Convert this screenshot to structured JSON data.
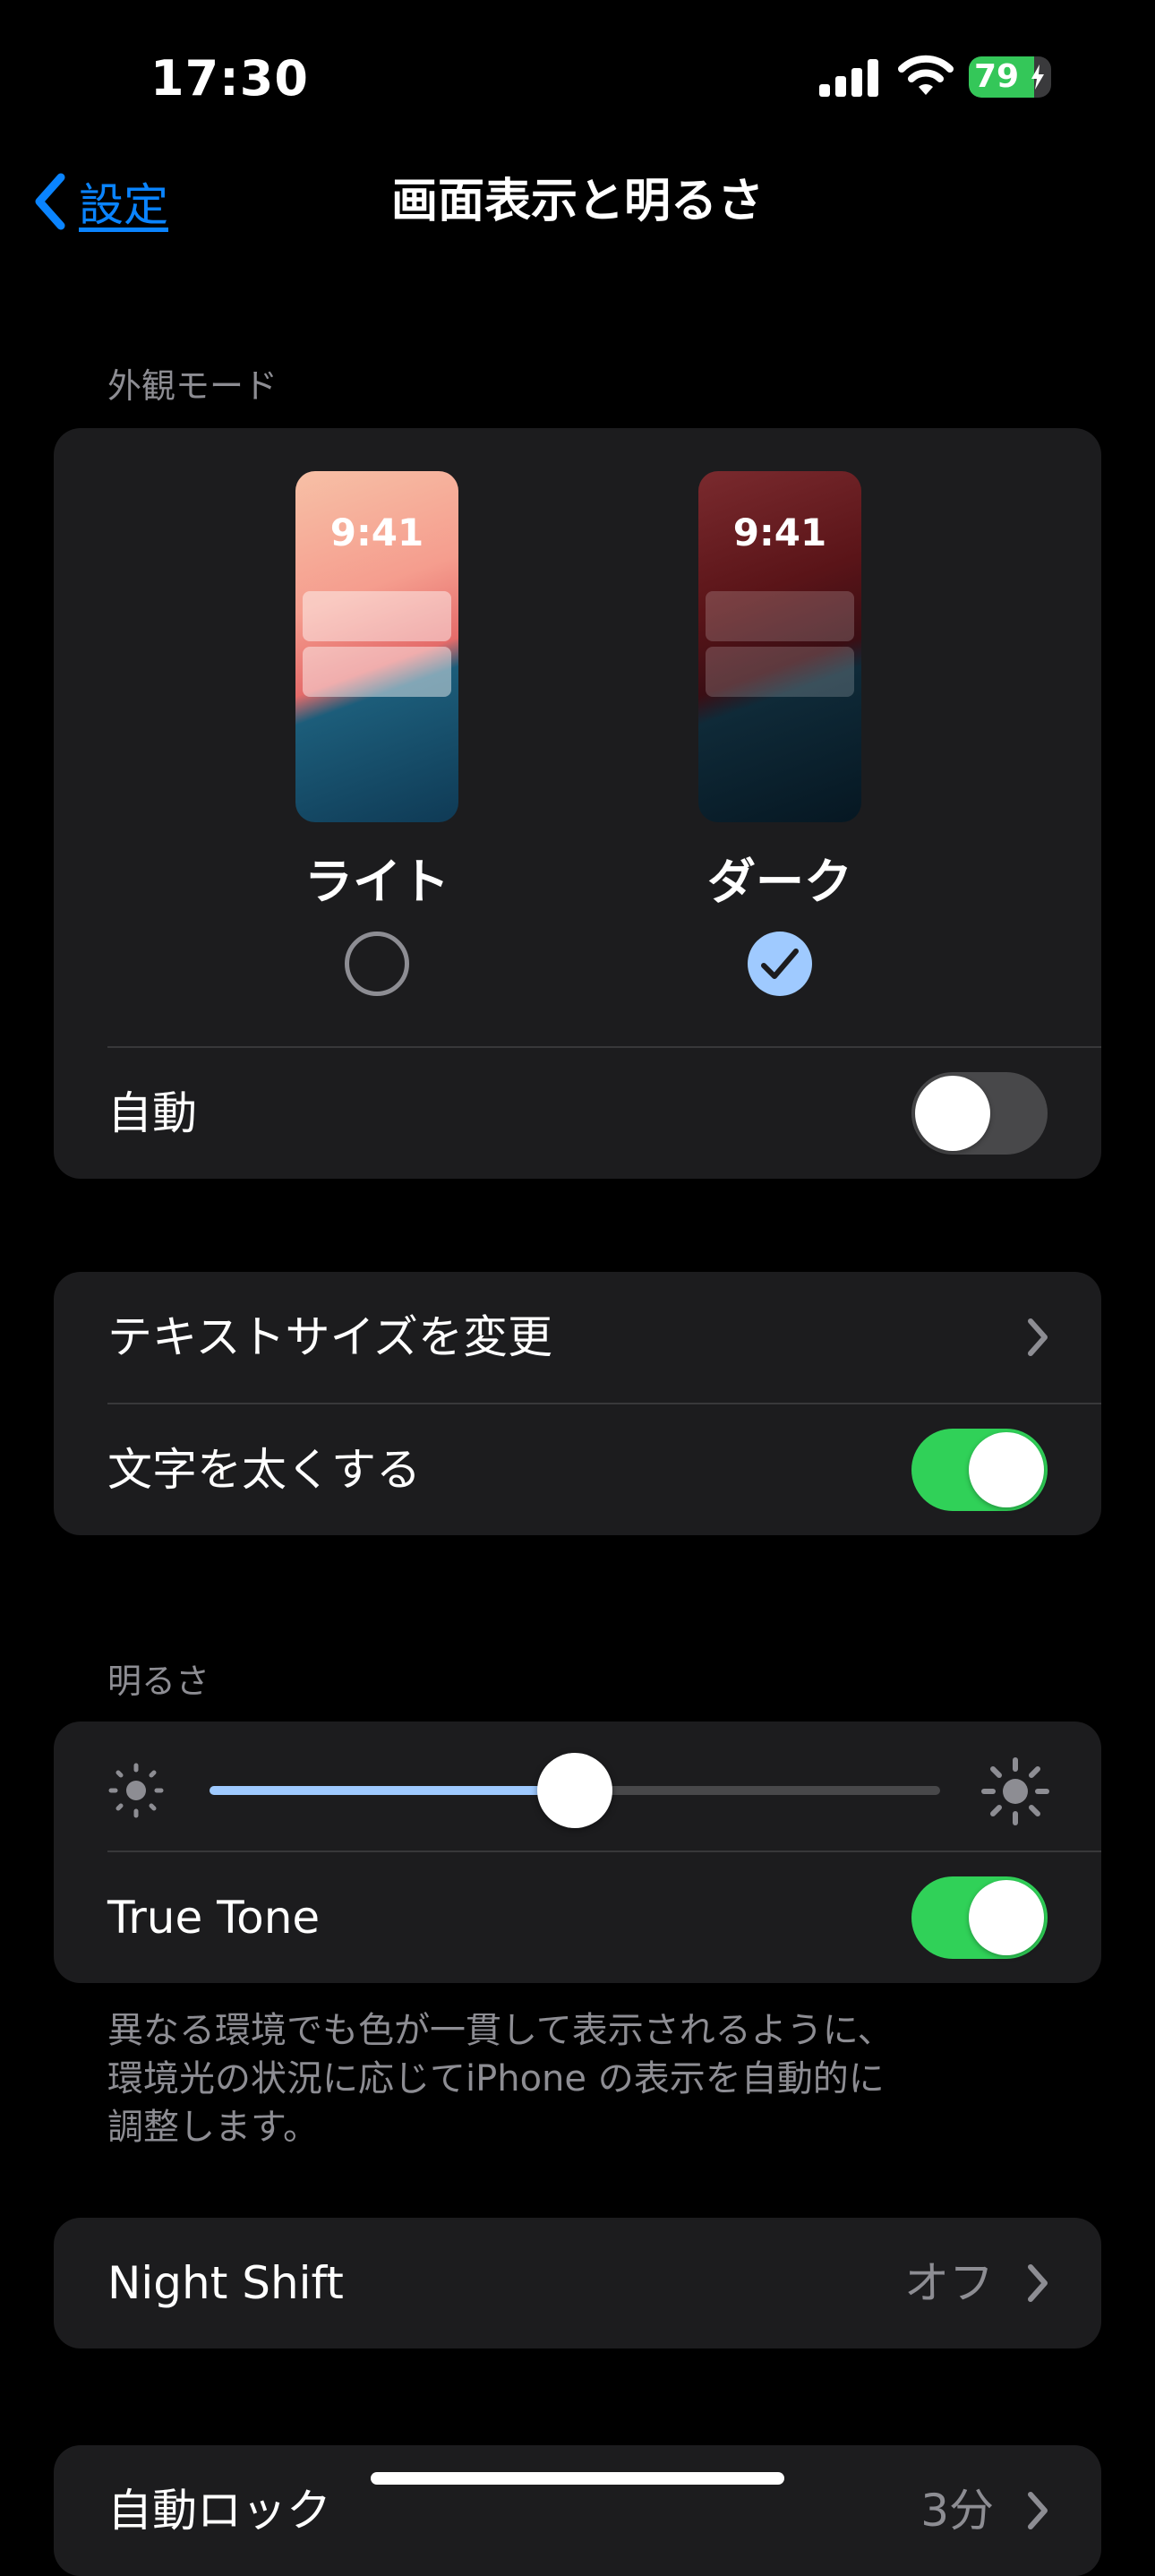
{
  "status_bar": {
    "time": "17:30",
    "battery": 79
  },
  "nav": {
    "back_label": "設定",
    "title": "画面表示と明るさ"
  },
  "appearance": {
    "header": "外観モード",
    "options": [
      {
        "label": "ライト",
        "preview_time": "9:41",
        "selected": false
      },
      {
        "label": "ダーク",
        "preview_time": "9:41",
        "selected": true
      }
    ],
    "auto_label": "自動",
    "auto_on": false
  },
  "text": {
    "text_size_label": "テキストサイズを変更",
    "bold_text_label": "文字を太くする",
    "bold_text_on": true
  },
  "brightness": {
    "header": "明るさ",
    "level": 0.5,
    "true_tone_label": "True Tone",
    "true_tone_on": true,
    "footer_lines": [
      "異なる環境でも色が一貫して表示されるように、",
      "環境光の状況に応じてiPhone の表示を自動的に",
      "調整します。"
    ]
  },
  "night_shift": {
    "label": "Night Shift",
    "value": "オフ"
  },
  "auto_lock": {
    "label": "自動ロック",
    "value": "3分"
  },
  "colors": {
    "accent": "#0a84ff",
    "toggle_on": "#30d158",
    "slider_fill": "#9fcaff",
    "group_bg": "#1c1c1e"
  }
}
